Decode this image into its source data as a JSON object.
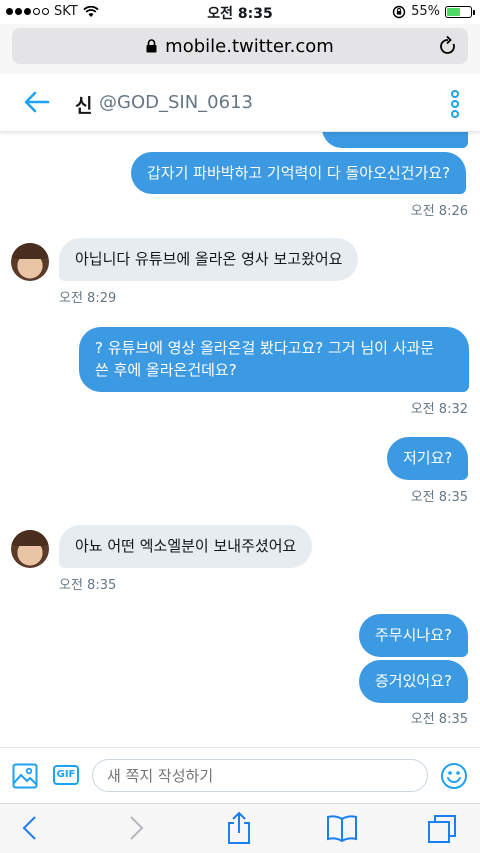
{
  "status_bar": {
    "carrier": "SKT",
    "time": "오전 8:35",
    "battery": "55%"
  },
  "browser": {
    "url": "mobile.twitter.com"
  },
  "header": {
    "name": "신",
    "handle": "@GOD_SIN_0613"
  },
  "messages": [
    {
      "text": "갑자기 파바박하고 기억력이 다 돌아오신건가요?",
      "timestamp": "오전 8:26"
    },
    {
      "text": "아닙니다 유튜브에 올라온 영사 보고왔어요",
      "timestamp": "오전 8:29"
    },
    {
      "line1": "? 유튜브에 영상 올라온걸 봤다고요? 그거 님이 사과문",
      "line2": "쓴 후에 올라온건데요?",
      "timestamp": "오전 8:32"
    },
    {
      "text": "저기요?",
      "timestamp": "오전 8:35"
    },
    {
      "text": "아뇨 어떤 엑소엘분이 보내주셨어요",
      "timestamp": "오전 8:35"
    },
    {
      "text": "주무시나요?"
    },
    {
      "text": "증거있어요?",
      "timestamp": "오전 8:35"
    }
  ],
  "composer": {
    "placeholder": "새 쪽지 작성하기",
    "gif_label": "GIF"
  },
  "colors": {
    "accent": "#1da1f2",
    "outgoing_bubble": "#3b9ae1",
    "incoming_bubble": "#e6ecf0",
    "battery_fill": "#4cd964"
  },
  "icons": {
    "back": "back-arrow-icon",
    "more": "kebab-menu-icon",
    "image": "image-icon",
    "gif": "gif-icon",
    "emoji": "emoji-icon",
    "browser_back": "chevron-left-icon",
    "browser_forward": "chevron-right-icon",
    "share": "share-icon",
    "bookmarks": "bookmarks-icon",
    "tabs": "tabs-icon"
  }
}
